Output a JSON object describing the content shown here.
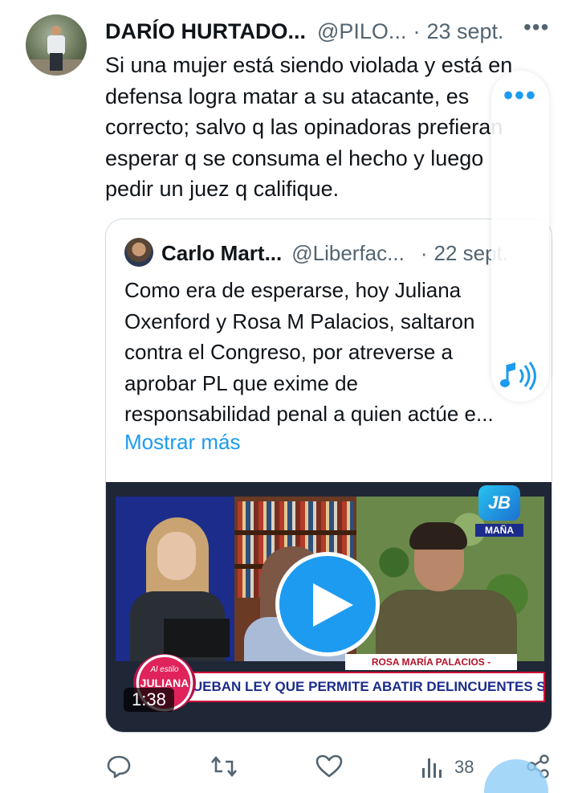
{
  "tweet": {
    "author_name": "DARÍO HURTADO...",
    "handle": "@PILO...",
    "separator": "·",
    "date": "23 sept.",
    "more_label": "•••",
    "text_lines": [
      "Si una mujer está siendo violada y está en",
      "defensa logra matar a su atacante, es",
      "correcto; salvo q las opinadoras prefieran",
      "esperar q se consuma el hecho y luego",
      "pedir un juez q califique."
    ]
  },
  "quote": {
    "author_name": "Carlo Mart...",
    "handle": "@Liberfac...",
    "separator": "·",
    "date": "22 sept.",
    "text_lines": [
      "Como era de esperarse, hoy Juliana",
      "Oxenford y Rosa M Palacios, saltaron",
      "contra el Congreso, por atreverse a",
      "aprobar PL que exime de",
      "responsabilidad penal a quien actúe e..."
    ],
    "show_more": "Mostrar más",
    "video": {
      "duration": "1:38",
      "channel_logo": "JB",
      "channel_tag": "MAÑA",
      "name_bar": "ROSA MARÍA PALACIOS - PERIODISTA",
      "ticker": "APRUEBAN LEY QUE PERMITE ABATIR DELINCUENTES SIN IR A PRISIÓN",
      "show_logo_line1": "Al estilo",
      "show_logo_line2": "JULIANA"
    }
  },
  "overlay": {
    "dots": "•••"
  },
  "actions": {
    "views_count": "38"
  },
  "icons": [
    "reply-icon",
    "retweet-icon",
    "like-icon",
    "views-icon",
    "share-icon",
    "play-icon",
    "speaker-icon",
    "more-icon"
  ],
  "colors": {
    "accent": "#1d9bf0",
    "secondary_text": "#536471",
    "primary_text": "#0f1419",
    "border": "#cfd9de"
  }
}
